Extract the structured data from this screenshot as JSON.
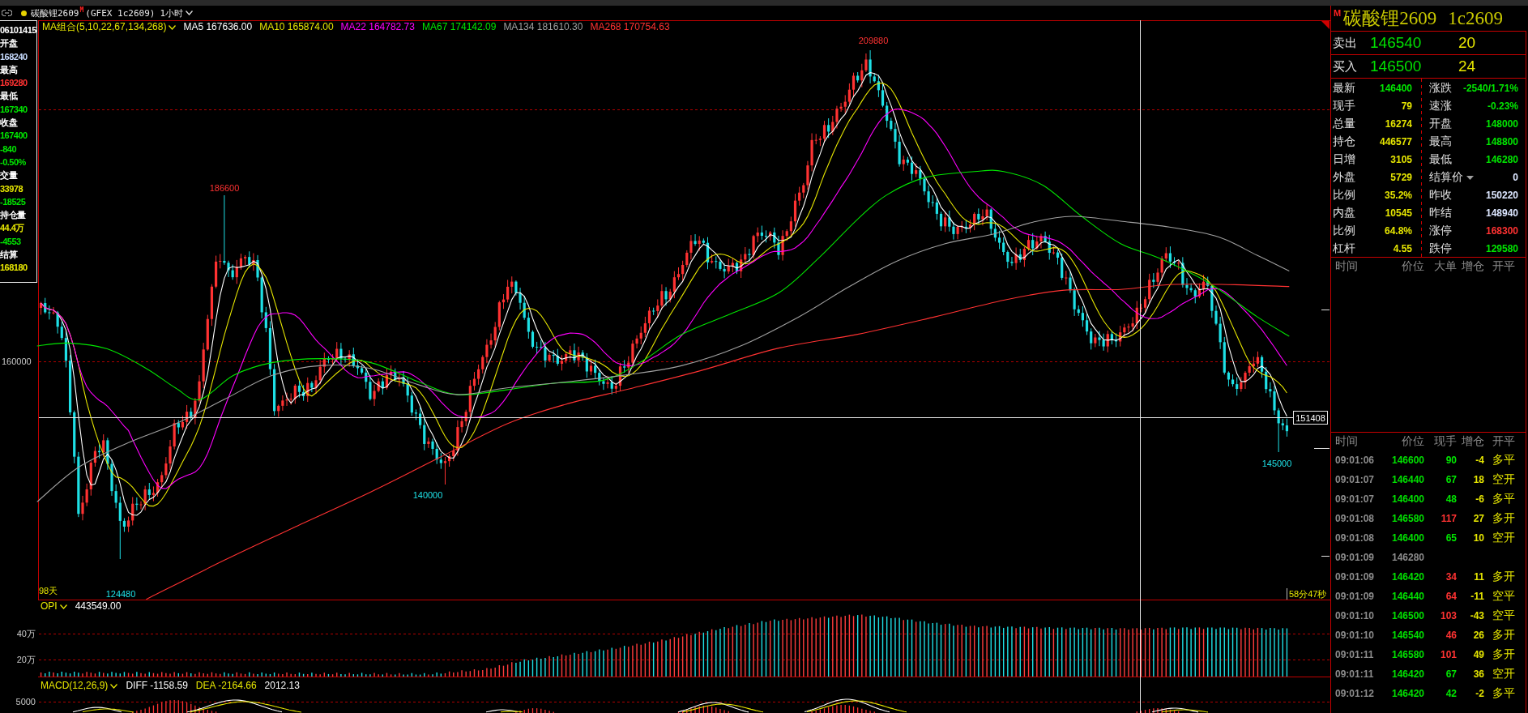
{
  "title_bar": {
    "name": "碳酸锂2609",
    "badge": "M",
    "code": "(GFEX 1c2609)",
    "period": "1小时"
  },
  "main_chart": {
    "indicator": "MA组合(5,10,22,67,134,268)",
    "moving_averages": [
      {
        "label": "MA5 167636.00",
        "color": "#ffffff"
      },
      {
        "label": "MA10 165874.00",
        "color": "#e6e600"
      },
      {
        "label": "MA22 164782.73",
        "color": "#ff00ff"
      },
      {
        "label": "MA67 174142.09",
        "color": "#00e600"
      },
      {
        "label": "MA134 181610.30",
        "color": "#a0a0a0"
      },
      {
        "label": "MA268 170754.63",
        "color": "#ff3232"
      }
    ],
    "info_box": [
      {
        "text": "06101415",
        "color": "#ffffff"
      },
      {
        "text": "开盘",
        "color": "#ffffff"
      },
      {
        "text": "168240",
        "color": "#c8dcff"
      },
      {
        "text": "最高",
        "color": "#ffffff"
      },
      {
        "text": "169280",
        "color": "#ff3232"
      },
      {
        "text": "最低",
        "color": "#ffffff"
      },
      {
        "text": "167340",
        "color": "#00e600"
      },
      {
        "text": "收盘",
        "color": "#ffffff"
      },
      {
        "text": "167400",
        "color": "#00e600"
      },
      {
        "text": "-840",
        "color": "#00e600"
      },
      {
        "text": "-0.50%",
        "color": "#00e600"
      },
      {
        "text": "交量",
        "color": "#ffffff"
      },
      {
        "text": "33978",
        "color": "#e6e600"
      },
      {
        "text": "-18525",
        "color": "#00e600"
      },
      {
        "text": "持仓量",
        "color": "#ffffff"
      },
      {
        "text": "44.4万",
        "color": "#e6e600"
      },
      {
        "text": "-4553",
        "color": "#00e600"
      },
      {
        "text": "结算",
        "color": "#ffffff"
      },
      {
        "text": "168180",
        "color": "#e6e600"
      }
    ],
    "axis_labels": [
      "160000"
    ],
    "price_marks": [
      {
        "text": "209880",
        "kind": "high"
      },
      {
        "text": "186600",
        "kind": "high"
      },
      {
        "text": "140000",
        "kind": "low"
      },
      {
        "text": "124480",
        "kind": "low"
      },
      {
        "text": "145000",
        "kind": "low"
      }
    ],
    "crosshair_price": "151408",
    "bar_count": "98天",
    "countdown": "58分47秒"
  },
  "opi_panel": {
    "indicator": "OPI",
    "value": "443549.00",
    "axis_labels": [
      "40万",
      "20万"
    ]
  },
  "macd_panel": {
    "indicator": "MACD(12,26,9)",
    "values": [
      {
        "text": "DIFF -1158.59",
        "color": "#ffffff"
      },
      {
        "text": "DEA -2164.66",
        "color": "#e6e600"
      },
      {
        "text": "2012.13",
        "color": "#ffffff"
      }
    ],
    "axis_labels": [
      "5000"
    ]
  },
  "quote_panel": {
    "badge": "M",
    "name": "碳酸锂2609",
    "code": "1c2609",
    "order_book": [
      {
        "label": "卖出",
        "price": "146540",
        "volume": "20"
      },
      {
        "label": "买入",
        "price": "146500",
        "volume": "24"
      }
    ],
    "stats": [
      {
        "cells": [
          {
            "label": "最新",
            "value": "146400",
            "color": "#00e600",
            "menu": false
          },
          {
            "label": "涨跌",
            "value": "-2540/1.71%",
            "color": "#00e600",
            "menu": false
          }
        ]
      },
      {
        "cells": [
          {
            "label": "现手",
            "value": "79",
            "color": "#e6e600",
            "menu": false
          },
          {
            "label": "速涨",
            "value": "-0.23%",
            "color": "#00e600",
            "menu": false
          }
        ]
      },
      {
        "cells": [
          {
            "label": "总量",
            "value": "16274",
            "color": "#e6e600",
            "menu": false
          },
          {
            "label": "开盘",
            "value": "148000",
            "color": "#00e600",
            "menu": false
          }
        ]
      },
      {
        "cells": [
          {
            "label": "持仓",
            "value": "446577",
            "color": "#e6e600",
            "menu": false
          },
          {
            "label": "最高",
            "value": "148800",
            "color": "#00e600",
            "menu": false
          }
        ]
      },
      {
        "cells": [
          {
            "label": "日增",
            "value": "3105",
            "color": "#e6e600",
            "menu": false
          },
          {
            "label": "最低",
            "value": "146280",
            "color": "#00e600",
            "menu": false
          }
        ]
      },
      {
        "cells": [
          {
            "label": "外盘",
            "value": "5729",
            "color": "#e6e600",
            "menu": false
          },
          {
            "label": "结算价",
            "value": "0",
            "color": "#dce6ff",
            "menu": true
          }
        ]
      },
      {
        "cells": [
          {
            "label": "比例",
            "value": "35.2%",
            "color": "#e6e600",
            "menu": false
          },
          {
            "label": "昨收",
            "value": "150220",
            "color": "#dce6ff",
            "menu": false
          }
        ]
      },
      {
        "cells": [
          {
            "label": "内盘",
            "value": "10545",
            "color": "#e6e600",
            "menu": false
          },
          {
            "label": "昨结",
            "value": "148940",
            "color": "#dce6ff",
            "menu": false
          }
        ]
      },
      {
        "cells": [
          {
            "label": "比例",
            "value": "64.8%",
            "color": "#e6e600",
            "menu": false
          },
          {
            "label": "涨停",
            "value": "168300",
            "color": "#ff3232",
            "menu": false
          }
        ]
      },
      {
        "cells": [
          {
            "label": "杠杆",
            "value": "4.55",
            "color": "#e6e600",
            "menu": false
          },
          {
            "label": "跌停",
            "value": "129580",
            "color": "#00e600",
            "menu": false
          }
        ]
      }
    ],
    "big_order_list": {
      "columns": [
        "时间",
        "价位",
        "大单",
        "增仓",
        "开平"
      ]
    },
    "tick_list": {
      "columns": [
        "时间",
        "价位",
        "现手",
        "增仓",
        "开平"
      ],
      "rows": [
        {
          "kind": "trade",
          "time": "09:01:06",
          "price": "146600",
          "volume": "90",
          "color": "#00e600",
          "change": "-4",
          "action": "多平"
        },
        {
          "kind": "trade",
          "time": "09:01:07",
          "price": "146440",
          "volume": "67",
          "color": "#00e600",
          "change": "18",
          "action": "空开"
        },
        {
          "kind": "trade",
          "time": "09:01:07",
          "price": "146400",
          "volume": "48",
          "color": "#00e600",
          "change": "-6",
          "action": "多平"
        },
        {
          "kind": "trade",
          "time": "09:01:08",
          "price": "146580",
          "volume": "117",
          "color": "#ff3232",
          "change": "27",
          "action": "多开"
        },
        {
          "kind": "trade",
          "time": "09:01:08",
          "price": "146400",
          "volume": "65",
          "color": "#00e600",
          "change": "10",
          "action": "空开"
        },
        {
          "kind": "quote",
          "time": "09:01:09",
          "price": "146280"
        },
        {
          "kind": "trade",
          "time": "09:01:09",
          "price": "146420",
          "volume": "34",
          "color": "#ff3232",
          "change": "11",
          "action": "多开"
        },
        {
          "kind": "trade",
          "time": "09:01:09",
          "price": "146440",
          "volume": "64",
          "color": "#ff3232",
          "change": "-11",
          "action": "空平"
        },
        {
          "kind": "trade",
          "time": "09:01:10",
          "price": "146500",
          "volume": "103",
          "color": "#ff3232",
          "change": "-43",
          "action": "空平"
        },
        {
          "kind": "trade",
          "time": "09:01:10",
          "price": "146540",
          "volume": "46",
          "color": "#ff3232",
          "change": "26",
          "action": "多开"
        },
        {
          "kind": "trade",
          "time": "09:01:11",
          "price": "146580",
          "volume": "101",
          "color": "#ff3232",
          "change": "49",
          "action": "多开"
        },
        {
          "kind": "trade",
          "time": "09:01:11",
          "price": "146420",
          "volume": "67",
          "color": "#00e600",
          "change": "36",
          "action": "空开"
        },
        {
          "kind": "trade",
          "time": "09:01:12",
          "price": "146420",
          "volume": "42",
          "color": "#00e600",
          "change": "-2",
          "action": "多平"
        }
      ]
    }
  }
}
